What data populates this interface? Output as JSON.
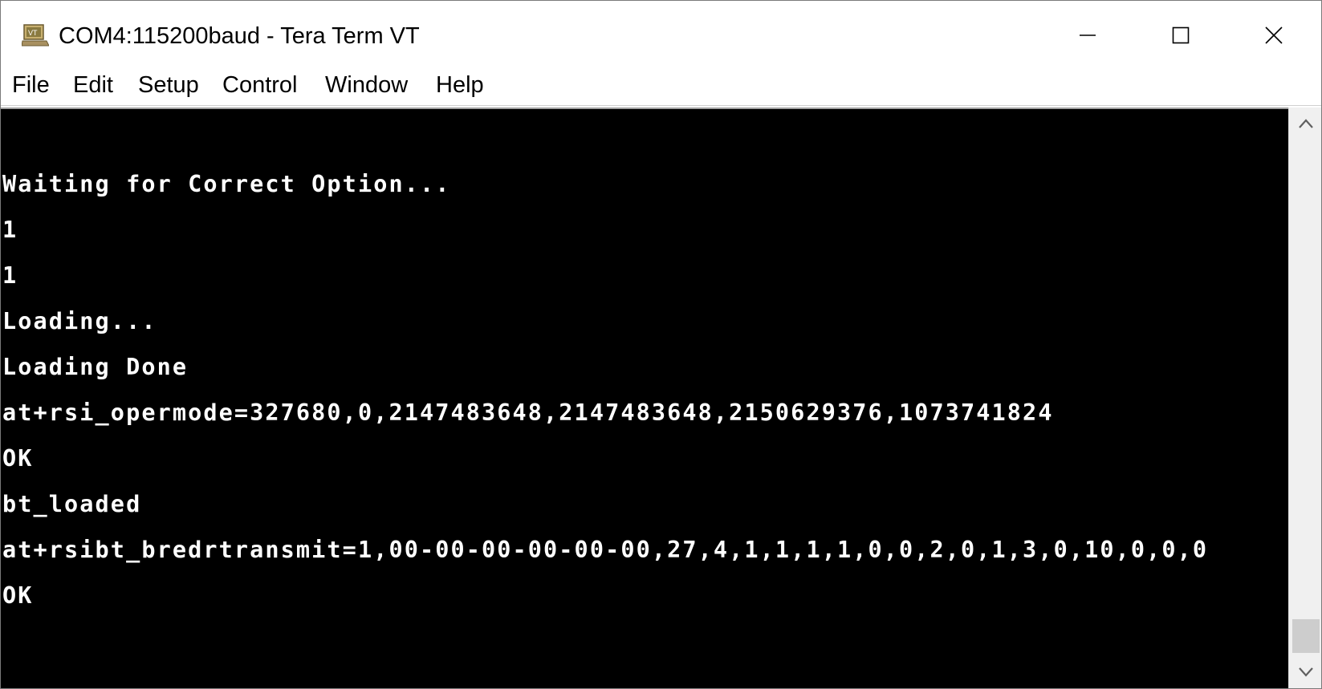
{
  "window": {
    "title": "COM4:115200baud - Tera Term VT"
  },
  "menubar": {
    "items": [
      {
        "label": "File"
      },
      {
        "label": "Edit"
      },
      {
        "label": "Setup"
      },
      {
        "label": "Control"
      },
      {
        "label": "Window"
      },
      {
        "label": "Help"
      }
    ]
  },
  "terminal": {
    "lines": [
      "Waiting for Correct Option...",
      "1",
      "1",
      "Loading...",
      "Loading Done",
      "at+rsi_opermode=327680,0,2147483648,2147483648,2150629376,1073741824",
      "OK",
      "bt_loaded",
      "at+rsibt_bredrtransmit=1,00-00-00-00-00-00,27,4,1,1,1,1,0,0,2,0,1,3,0,10,0,0,0",
      "OK"
    ]
  },
  "scrollbar": {
    "position": 0.97
  }
}
